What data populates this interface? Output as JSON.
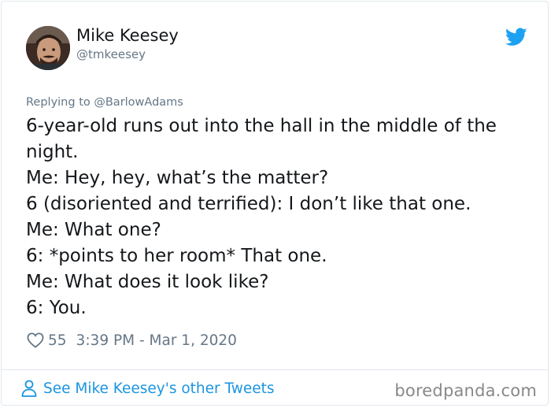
{
  "author": {
    "display_name": "Mike Keesey",
    "handle": "@tmkeesey"
  },
  "reply": {
    "label": "Replying to @BarlowAdams"
  },
  "tweet": {
    "lines": [
      "6-year-old runs out into the hall in the middle of the",
      "night.",
      "Me: Hey, hey, what’s the matter?",
      "6 (disoriented and terrified): I don’t like that one.",
      "Me: What one?",
      "6: *points to her room* That one.",
      "Me: What does it look like?",
      "6: You."
    ]
  },
  "meta": {
    "likes": "55",
    "timestamp": "3:39 PM - Mar 1, 2020"
  },
  "footer": {
    "see_more": "See Mike Keesey's other Tweets"
  },
  "watermark": "boredpanda.com",
  "colors": {
    "twitter_blue": "#1da1f2",
    "link_blue": "#1b95e0",
    "secondary_text": "#657786",
    "primary_text": "#14171a"
  },
  "icons": {
    "brand": "twitter-bird-icon",
    "like": "heart-icon",
    "profile": "person-icon"
  }
}
